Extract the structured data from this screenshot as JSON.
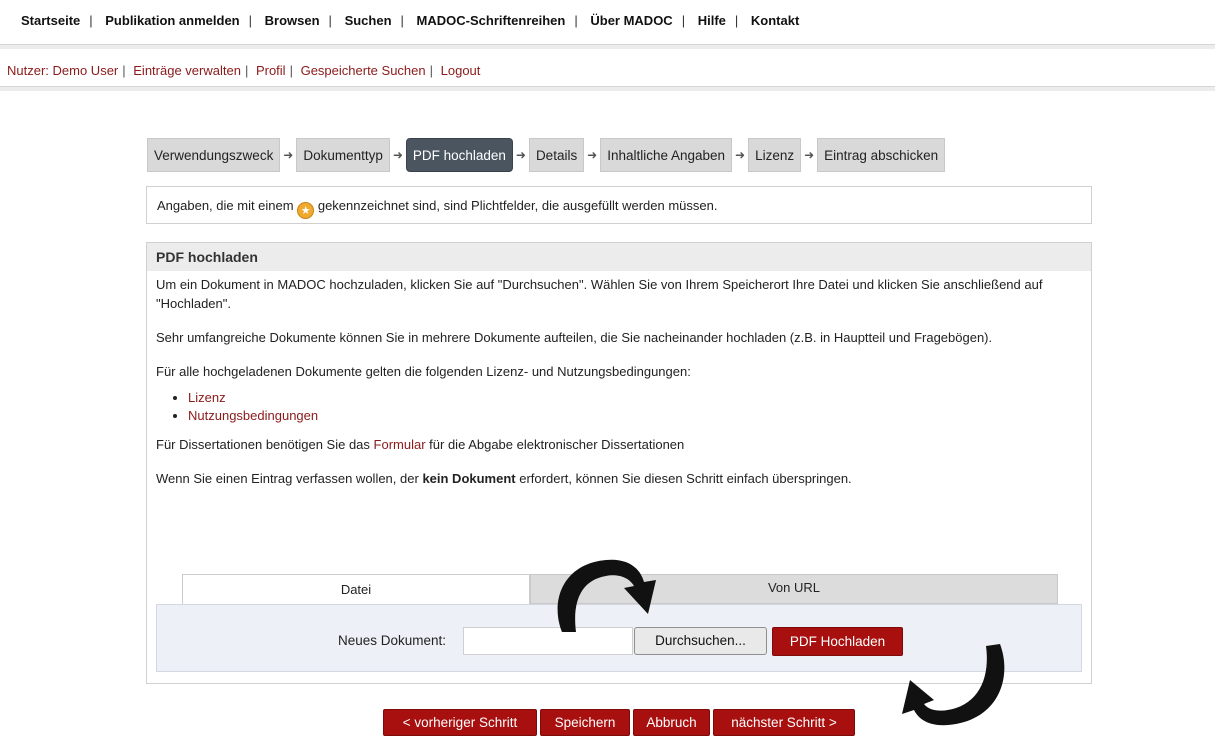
{
  "topnav": [
    "Startseite",
    "Publikation anmelden",
    "Browsen",
    "Suchen",
    "MADOC-Schriftenreihen",
    "Über MADOC",
    "Hilfe",
    "Kontakt"
  ],
  "usernav": [
    "Nutzer: Demo User",
    "Einträge verwalten",
    "Profil",
    "Gespeicherte Suchen",
    "Logout"
  ],
  "steps": [
    "Verwendungszweck",
    "Dokumenttyp",
    "PDF hochladen",
    "Details",
    "Inhaltliche Angaben",
    "Lizenz",
    "Eintrag abschicken"
  ],
  "active_step": "PDF hochladen",
  "notice": {
    "before": "Angaben, die mit einem",
    "after": "gekennzeichnet sind, sind Plichtfelder, die ausgefüllt werden müssen."
  },
  "section": {
    "title": "PDF hochladen",
    "p1": "Um ein Dokument in MADOC hochzuladen, klicken Sie auf \"Durchsuchen\". Wählen Sie von Ihrem Speicherort Ihre Datei und klicken Sie anschließend auf \"Hochladen\".",
    "p2": "Sehr umfangreiche Dokumente können Sie in mehrere Dokumente aufteilen, die Sie nacheinander hochladen (z.B. in Hauptteil und Fragebögen).",
    "p3": "Für alle hochgeladenen Dokumente gelten die folgenden Lizenz- und Nutzungsbedingungen:",
    "links": [
      "Lizenz",
      "Nutzungsbedingungen"
    ],
    "p4_before": "Für Dissertationen benötigen Sie das",
    "p4_link": "Formular",
    "p4_after": "für die Abgabe elektronischer Dissertationen",
    "p5_before": "Wenn Sie einen Eintrag verfassen wollen, der",
    "p5_bold": "kein Dokument",
    "p5_after": "erfordert, können Sie diesen Schritt einfach überspringen."
  },
  "upload": {
    "tab_file": "Datei",
    "tab_url": "Von URL",
    "label": "Neues Dokument:",
    "value": "",
    "browse": "Durchsuchen...",
    "upload_button": "PDF Hochladen"
  },
  "buttons": {
    "prev": "< vorheriger Schritt",
    "save": "Speichern",
    "cancel": "Abbruch",
    "next": "nächster Schritt >"
  },
  "colors": {
    "accent": "#a80f0f",
    "link": "#8b1a1a",
    "active_step": "#4a5560"
  }
}
